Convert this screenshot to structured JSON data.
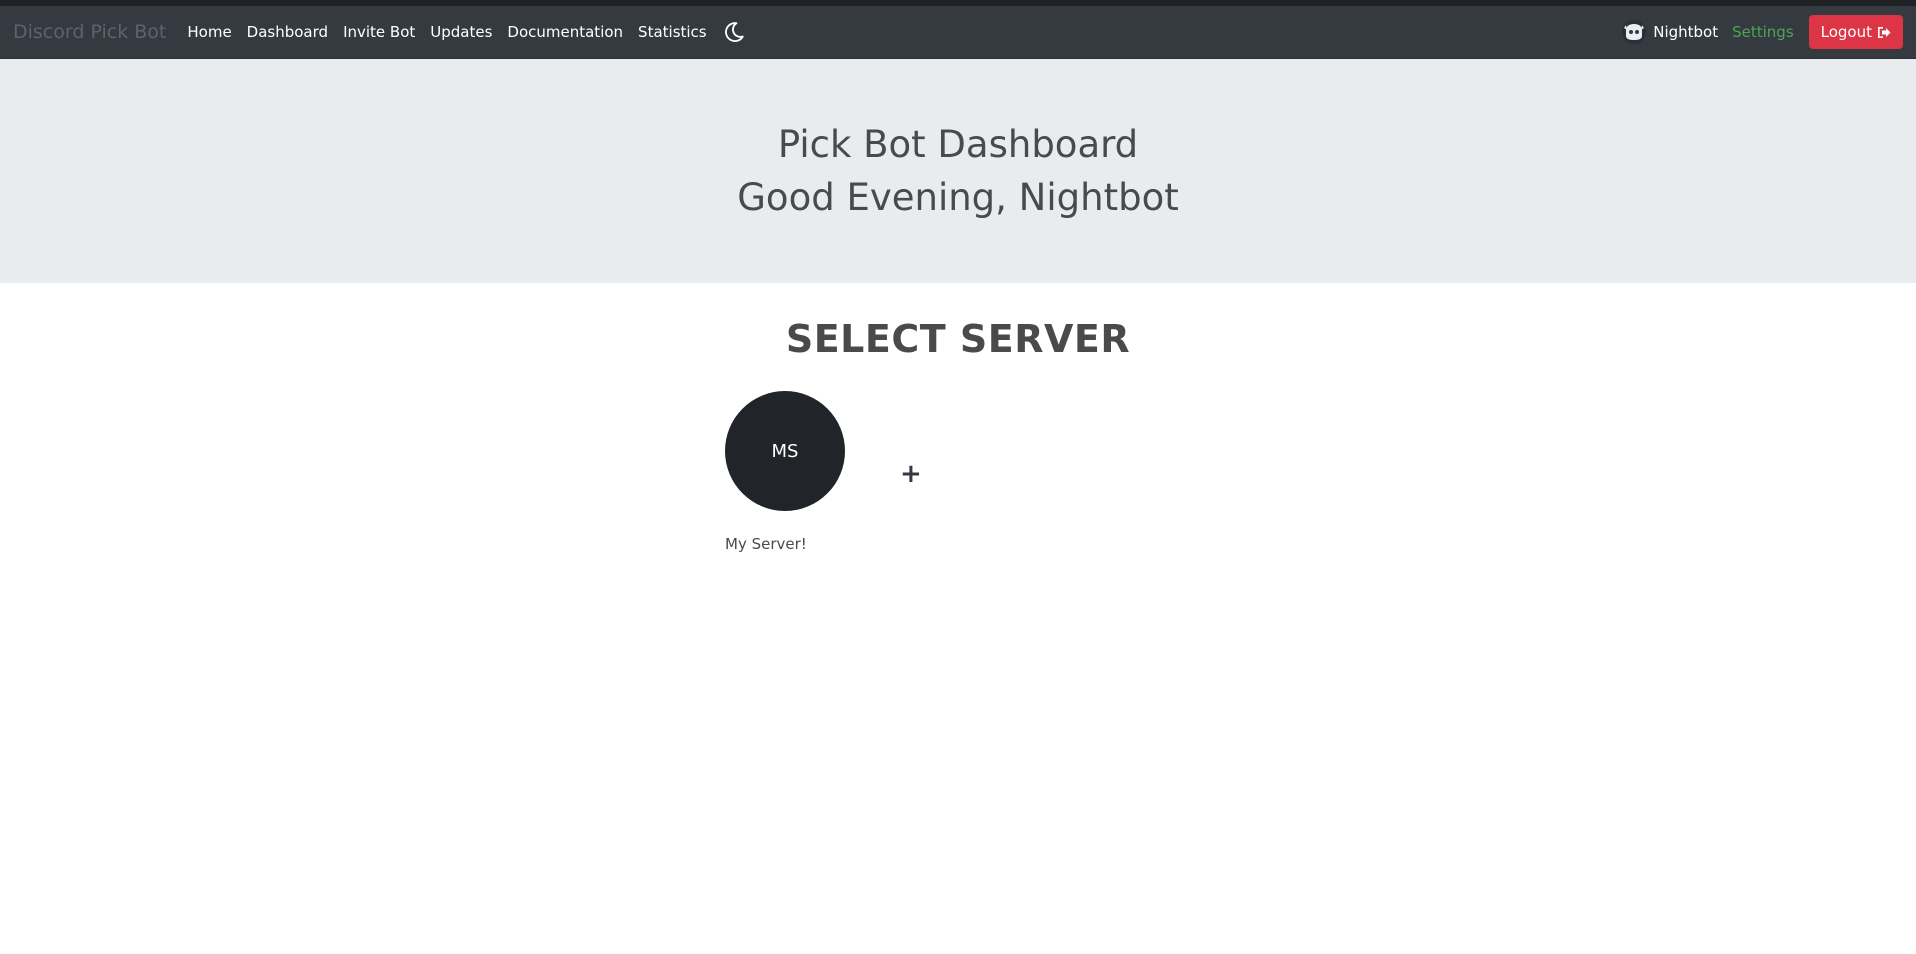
{
  "navbar": {
    "brand": "Discord Pick Bot",
    "items": [
      {
        "label": "Home"
      },
      {
        "label": "Dashboard"
      },
      {
        "label": "Invite Bot"
      },
      {
        "label": "Updates"
      },
      {
        "label": "Documentation"
      },
      {
        "label": "Statistics"
      }
    ],
    "theme_icon": "moon-icon",
    "user": {
      "name": "Nightbot",
      "avatar_icon": "nightbot-avatar"
    },
    "settings_label": "Settings",
    "logout_label": "Logout",
    "logout_icon": "sign-out-icon"
  },
  "hero": {
    "title": "Pick Bot Dashboard",
    "greeting": "Good Evening, Nightbot"
  },
  "main": {
    "heading": "SELECT SERVER",
    "servers": [
      {
        "initials": "MS",
        "name": "My Server!"
      }
    ],
    "add_label": "+"
  },
  "colors": {
    "navbar_bg": "#343a40",
    "hero_bg": "#e9ecef",
    "logout_bg": "#dc3545",
    "settings_color": "#4ca554",
    "server_circle_bg": "#212529"
  }
}
